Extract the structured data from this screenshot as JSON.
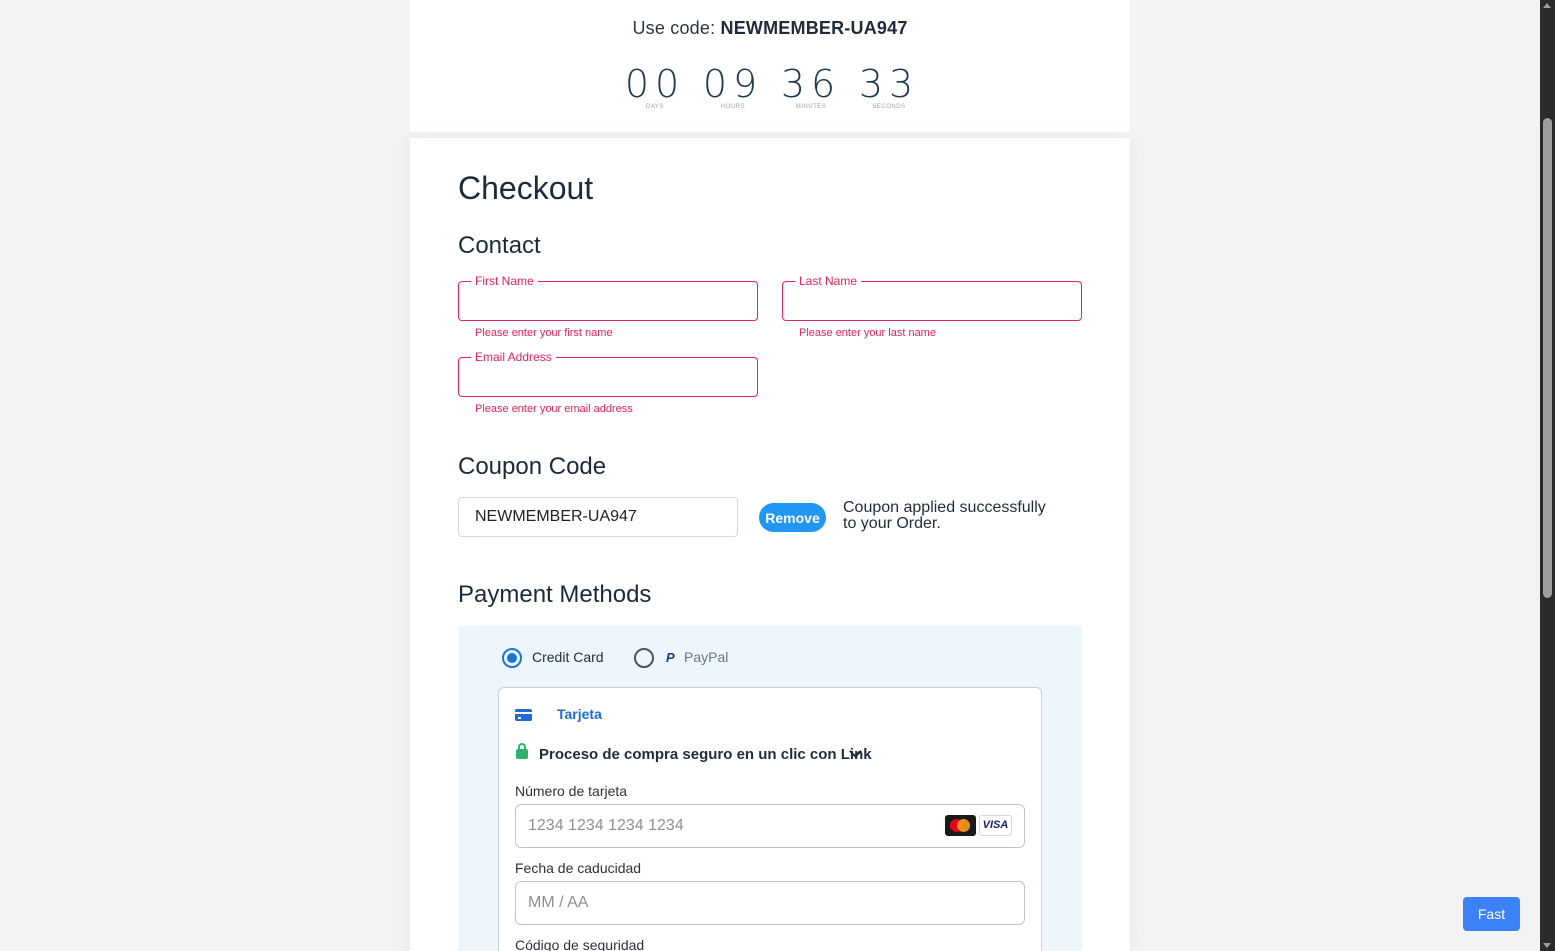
{
  "promo": {
    "use_code_prefix": "Use code:",
    "code": "NEWMEMBER-UA947",
    "countdown": [
      {
        "value": "00",
        "label": "DAYS"
      },
      {
        "value": "09",
        "label": "HOURS"
      },
      {
        "value": "36",
        "label": "MINUTES"
      },
      {
        "value": "33",
        "label": "SECONDS"
      }
    ]
  },
  "checkout": {
    "title": "Checkout",
    "contact": {
      "heading": "Contact",
      "first_name_label": "First Name",
      "first_name_value": "",
      "first_name_error": "Please enter your first name",
      "last_name_label": "Last Name",
      "last_name_value": "",
      "last_name_error": "Please enter your last name",
      "email_label": "Email Address",
      "email_value": "",
      "email_error": "Please enter your email address"
    },
    "coupon": {
      "heading": "Coupon Code",
      "value": "NEWMEMBER-UA947",
      "remove_label": "Remove",
      "message": "Coupon applied successfully to your Order."
    },
    "payment": {
      "heading": "Payment Methods",
      "options": [
        {
          "label": "Credit Card",
          "selected": true
        },
        {
          "label": "PayPal",
          "selected": false
        }
      ],
      "card_tab_label": "Tarjeta",
      "link_text": "Proceso de compra seguro en un clic con Link",
      "card_number_label": "Número de tarjeta",
      "card_number_placeholder": "1234 1234 1234 1234",
      "expiry_label": "Fecha de caducidad",
      "expiry_placeholder": "MM / AA",
      "cvc_label": "Código de seguridad",
      "card_brands": [
        "mastercard-icon",
        "visa-icon"
      ],
      "visa_text": "VISA"
    }
  },
  "fast_button_label": "Fast",
  "colors": {
    "error": "#e0245e",
    "accent": "#2196f3",
    "link_blue": "#1e6bd6",
    "panel_bg": "#eef6fd"
  }
}
